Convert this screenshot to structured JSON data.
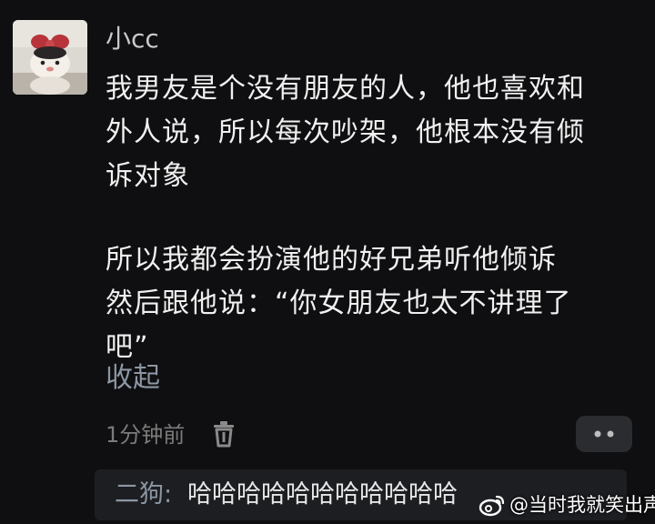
{
  "comment": {
    "username": "小cc",
    "paragraphs": [
      {
        "lines": [
          "我男友是个没有朋友的人，他也喜欢和",
          "外人说，所以每次吵架，他根本没有倾",
          "诉对象"
        ]
      },
      {
        "lines": [
          "所以我都会扮演他的好兄弟听他倾诉",
          "然后跟他说：“你女朋友也太不讲理了",
          "吧”"
        ]
      }
    ],
    "collapse_label": "收起",
    "time": "1分钟前"
  },
  "icons": {
    "trash": "trash-icon",
    "more": "more-dots-icon",
    "watermark_logo": "weibo-logo-icon"
  },
  "reply": {
    "author": "二狗:",
    "text": "哈哈哈哈哈哈哈哈哈哈哈"
  },
  "watermark": {
    "text": "@当时我就笑出声了"
  },
  "colors": {
    "background": "#0f0f11",
    "text_primary": "#f0f0f0",
    "username": "#c9c9c9",
    "link": "#8c97a5",
    "meta": "#7b7b7b",
    "reply_bg": "#1d1e22",
    "button_bg": "#2b2c30"
  }
}
